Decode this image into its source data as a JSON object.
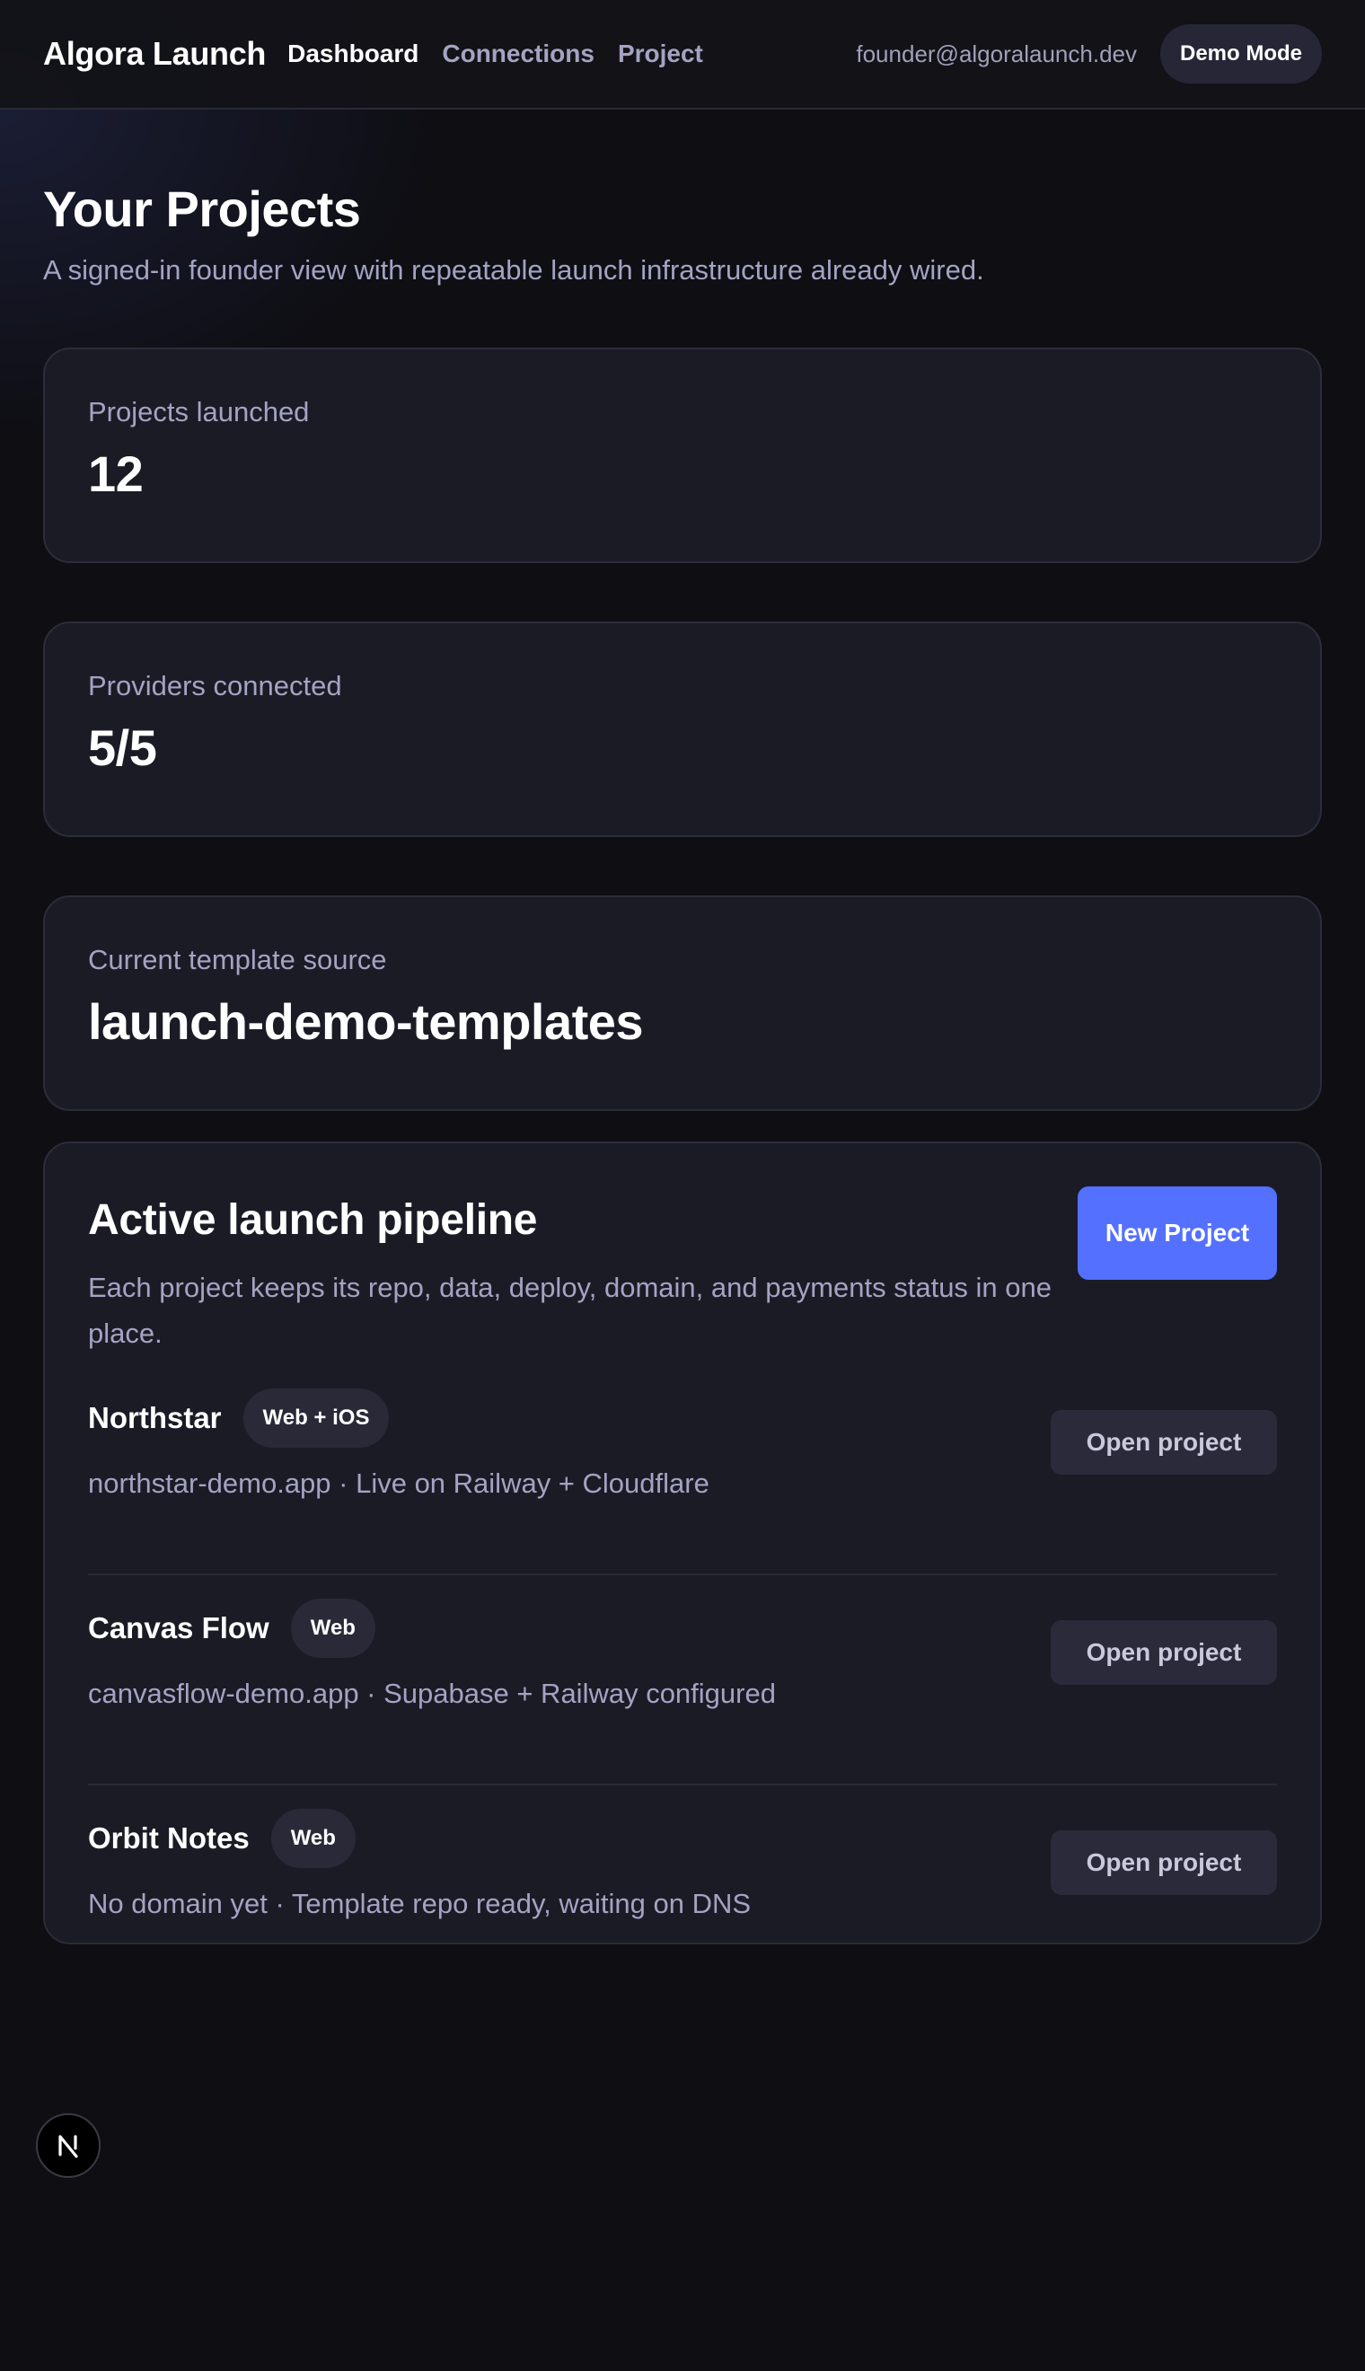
{
  "header": {
    "brand": "Algora Launch",
    "nav": [
      {
        "label": "Dashboard",
        "active": true
      },
      {
        "label": "Connections",
        "active": false
      },
      {
        "label": "Project",
        "active": false
      }
    ],
    "user_email": "founder@algoralaunch.dev",
    "mode_label": "Demo Mode"
  },
  "page": {
    "title": "Your Projects",
    "subtitle": "A signed-in founder view with repeatable launch infrastructure already wired."
  },
  "stats": [
    {
      "label": "Projects launched",
      "value": "12"
    },
    {
      "label": "Providers connected",
      "value": "5/5"
    },
    {
      "label": "Current template source",
      "value": "launch-demo-templates"
    }
  ],
  "pipeline": {
    "title": "Active launch pipeline",
    "description": "Each project keeps its repo, data, deploy, domain, and payments status in one place.",
    "new_project_label": "New Project",
    "projects": [
      {
        "name": "Northstar",
        "badge": "Web + iOS",
        "meta": "northstar-demo.app · Live on Railway + Cloudflare",
        "action": "Open project"
      },
      {
        "name": "Canvas Flow",
        "badge": "Web",
        "meta": "canvasflow-demo.app · Supabase + Railway configured",
        "action": "Open project"
      },
      {
        "name": "Orbit Notes",
        "badge": "Web",
        "meta": "No domain yet · Template repo ready, waiting on DNS",
        "action": "Open project"
      }
    ]
  },
  "colors": {
    "background": "#0e0e13",
    "card": "#1b1b25",
    "accent": "#5470ff",
    "muted_text": "#a3a3c4"
  },
  "icons": {
    "dev_badge": "nextjs-logo-icon"
  }
}
